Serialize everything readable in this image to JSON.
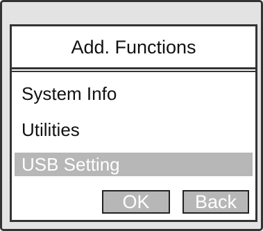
{
  "dialog": {
    "title": "Add. Functions"
  },
  "menu": {
    "items": [
      {
        "label": "System Info",
        "selected": false
      },
      {
        "label": "Utilities",
        "selected": false
      },
      {
        "label": "USB Setting",
        "selected": true
      }
    ]
  },
  "buttons": {
    "ok_label": "OK",
    "back_label": "Back"
  },
  "colors": {
    "frame_bg": "#e3e3e3",
    "border": "#333333",
    "highlight": "#b7b7b7",
    "highlight_text": "#ffffff"
  }
}
